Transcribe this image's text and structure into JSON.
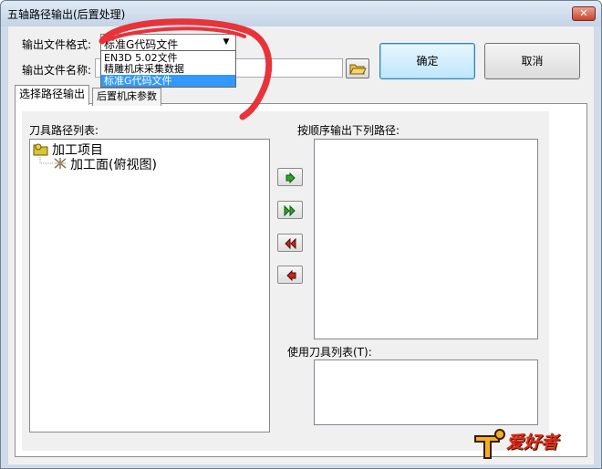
{
  "window": {
    "title": "五轴路径输出(后置处理)",
    "close_glyph": "✕"
  },
  "form": {
    "file_format_label": "输出文件格式:",
    "file_format_value": "标准G代码文件",
    "file_format_options": [
      "EN3D 5.02文件",
      "精雕机床采集数据",
      "标准G代码文件"
    ],
    "file_name_label": "输出文件名称:",
    "file_name_value": ""
  },
  "buttons": {
    "ok": "确定",
    "cancel": "取消"
  },
  "tabs": [
    {
      "label": "选择路径输出",
      "active": true
    },
    {
      "label": "后置机床参数",
      "active": false
    }
  ],
  "panel": {
    "toolpath_list_label": "刀具路径列表:",
    "output_order_label": "按顺序输出下列路径:",
    "tool_list_label": "使用刀具列表(T):",
    "tree": [
      {
        "label": "加工项目",
        "icon": "folder-project-icon",
        "level": 0
      },
      {
        "label": "加工面(俯视图)",
        "icon": "surface-icon",
        "level": 1
      }
    ]
  },
  "watermark": {
    "text": "爱好者"
  },
  "colors": {
    "accent_selected": "#3399ff",
    "annotation_red": "#e8333a",
    "arrow_green": "#2fa22f",
    "arrow_red": "#c0281f"
  }
}
